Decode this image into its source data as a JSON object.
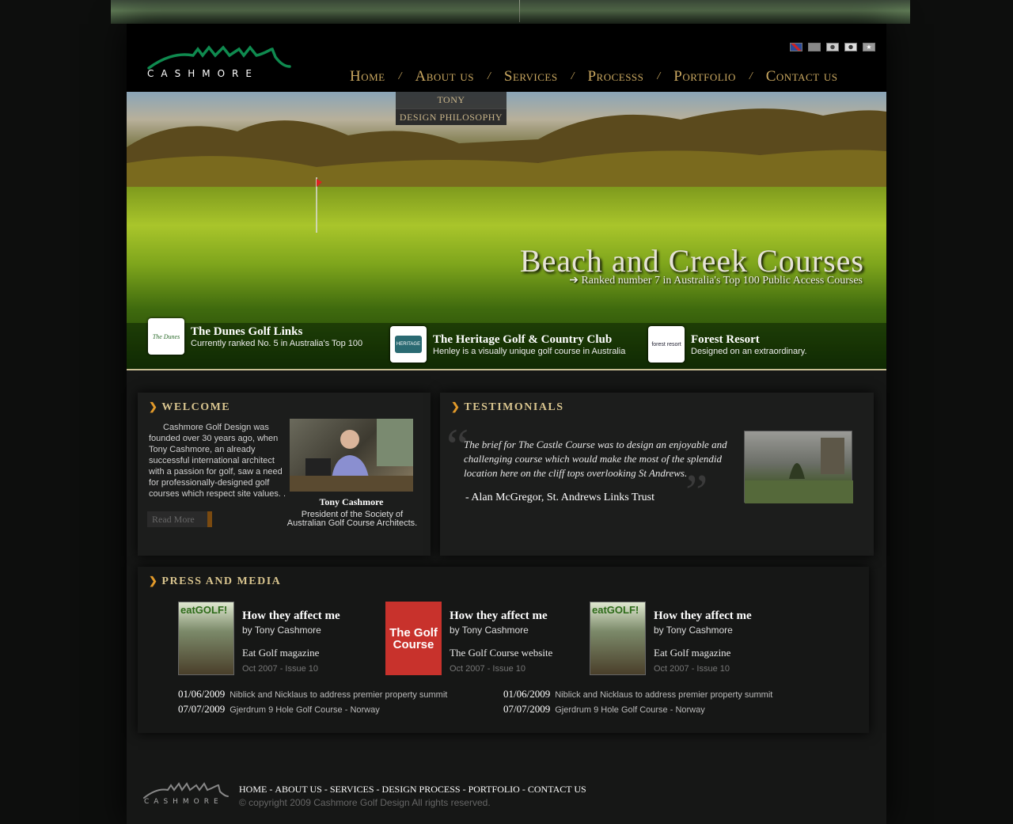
{
  "brand": {
    "logo_text": "CASHMORE"
  },
  "flags": [
    {
      "name": "uk-flag-icon",
      "color": "#2a4a9a"
    },
    {
      "name": "china-flag-icon",
      "color": "#888888"
    },
    {
      "name": "japan-flag-icon",
      "color": "#cccccc"
    },
    {
      "name": "korea-flag-icon",
      "color": "#dddddd"
    },
    {
      "name": "vietnam-flag-icon",
      "color": "#999999"
    }
  ],
  "nav": {
    "home": "Home",
    "about": "About us",
    "services": "Services",
    "process": "Processs",
    "portfolio": "Portfolio",
    "contact": "Contact us",
    "separator": "/"
  },
  "dropdown": {
    "item1": "TONY",
    "item2": "DESIGN PHILOSOPHY"
  },
  "hero": {
    "title": "Beach and Creek Courses",
    "subtitle": "➔ Ranked number 7 in Australia's Top 100 Public Access Courses"
  },
  "features": [
    {
      "title": "The Dunes Golf Links",
      "desc": "Currently ranked No. 5 in Australia's Top 100",
      "logo_text": "The Dunes"
    },
    {
      "title": "The Heritage Golf & Country Club",
      "desc": "Henley is a visually unique golf course in Australia",
      "logo_text": "HERITAGE"
    },
    {
      "title": "Forest Resort",
      "desc": "Designed on an extraordinary.",
      "logo_text": "forest resort"
    }
  ],
  "welcome": {
    "heading": "WELCOME",
    "text": "Cashmore Golf Design was founded over 30 years ago, when Tony Cashmore, an already successful international architect with a passion for golf, saw a need for professionally-designed golf courses which respect site values. .",
    "name": "Tony Cashmore",
    "caption": "President of the Society of Australian Golf Course Architects.",
    "read_more": "Read More"
  },
  "testimonials": {
    "heading": "TESTIMONIALS",
    "quote": "The brief for The Castle Course was to design an enjoyable and challenging course which would make the most of the splendid location here on the cliff tops overlooking St Andrews.",
    "author": "- Alan McGregor, St. Andrews Links Trust",
    "open_mark": "“",
    "close_mark": "”"
  },
  "press": {
    "heading": "PRESS AND MEDIA",
    "items": [
      {
        "title": "How they affect me",
        "by": "by Tony Cashmore",
        "source": "Eat Golf magazine",
        "date": "Oct 2007 - Issue 10",
        "cover_text": "eatGOLF!"
      },
      {
        "title": "How they affect me",
        "by": "by Tony Cashmore",
        "source": "The Golf Course website",
        "date": "Oct 2007 - Issue 10",
        "cover_text": "The Golf Course"
      },
      {
        "title": "How they affect me",
        "by": "by Tony Cashmore",
        "source": "Eat Golf magazine",
        "date": "Oct 2007 - Issue 10",
        "cover_text": "eatGOLF!"
      }
    ],
    "news": [
      {
        "date": "01/06/2009",
        "text": "Niblick and Nicklaus to address premier property summit"
      },
      {
        "date": "07/07/2009",
        "text": "Gjerdrum 9 Hole Golf Course - Norway"
      },
      {
        "date": "01/06/2009",
        "text": "Niblick and Nicklaus to address premier property summit"
      },
      {
        "date": "07/07/2009",
        "text": "Gjerdrum 9 Hole Golf Course - Norway"
      }
    ]
  },
  "footer": {
    "logo_text": "CASHMORE",
    "home": "HOME",
    "about": "ABOUT US",
    "services": "SERVICES",
    "process": "DESIGN PROCESS",
    "portfolio": "PORTFOLIO",
    "contact": "CONTACT US",
    "separator": " - ",
    "copyright": "© copyright 2009 Cashmore Golf Design All rights reserved."
  },
  "colors": {
    "accent": "#caa860",
    "logo_green": "#0f8a4f",
    "background": "#0d0e0d"
  }
}
